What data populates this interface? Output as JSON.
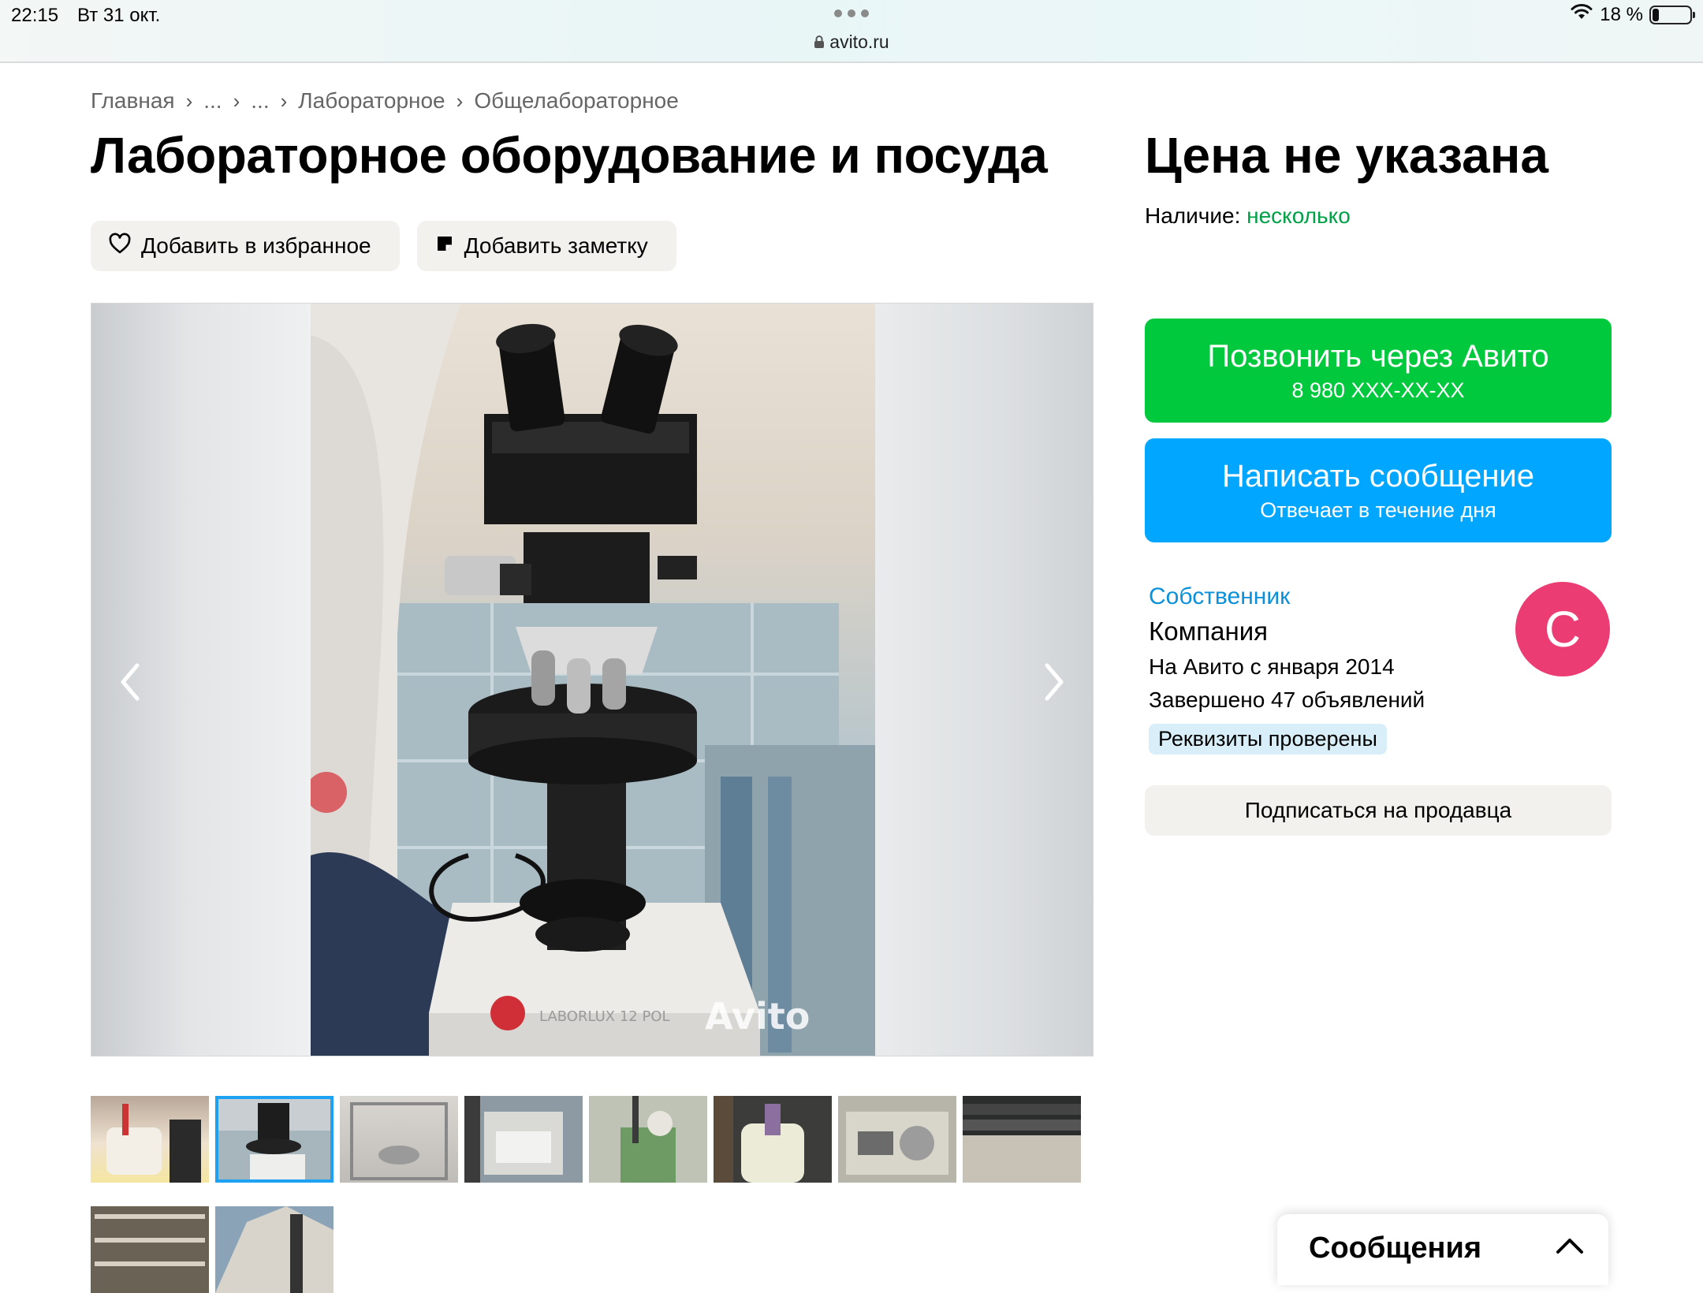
{
  "status_bar": {
    "time": "22:15",
    "date": "Вт 31 окт.",
    "url": "avito.ru",
    "battery": "18 %",
    "battery_level": 0.18
  },
  "breadcrumb": [
    "Главная",
    "...",
    "...",
    "Лабораторное",
    "Общелабораторное"
  ],
  "listing": {
    "title": "Лабораторное оборудование и посуда",
    "add_favorite_label": "Добавить в избранное",
    "add_note_label": "Добавить заметку"
  },
  "gallery": {
    "photo_labels": [
      "LABORLUX 12 POL",
      "Avito"
    ],
    "thumbnail_count": 10,
    "selected_index": 1
  },
  "sidebar": {
    "price": "Цена не указана",
    "availability_label": "Наличие:",
    "availability_value": "несколько",
    "call_button": {
      "label": "Позвонить через Авито",
      "phone": "8 980 XXX-XX-XX"
    },
    "message_button": {
      "label": "Написать сообщение",
      "sub": "Отвечает в течение дня"
    },
    "seller": {
      "type": "Собственник",
      "name": "Компания",
      "since": "На Авито с января 2014",
      "completed": "Завершено 47 объявлений",
      "badge": "Реквизиты проверены",
      "avatar_letter": "С"
    },
    "subscribe_label": "Подписаться на продавца"
  },
  "messages_panel": {
    "label": "Сообщения"
  },
  "colors": {
    "call_green": "#00c93d",
    "message_blue": "#00a6ff",
    "availability_green": "#00a046",
    "seller_link": "#0a91d9",
    "avatar_pink": "#ec3c74",
    "selected_thumb_border": "#1da1f2"
  }
}
